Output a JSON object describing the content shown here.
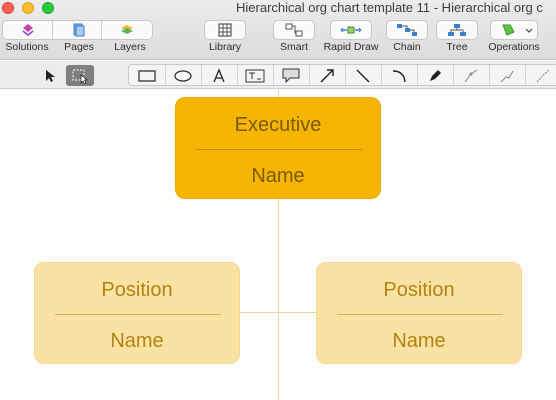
{
  "window": {
    "title": "Hierarchical org chart template 11 - Hierarchical org c"
  },
  "toolbar": {
    "solutions_label": "Solutions",
    "pages_label": "Pages",
    "layers_label": "Layers",
    "library_label": "Library",
    "smart_label": "Smart",
    "rapid_draw_label": "Rapid Draw",
    "chain_label": "Chain",
    "tree_label": "Tree",
    "operations_label": "Operations"
  },
  "drawing_tools": [
    "pointer-tool",
    "select-area-tool",
    "rectangle-tool",
    "ellipse-tool",
    "text-tool",
    "text-block-tool",
    "callout-tool",
    "arrow-tool",
    "line-tool",
    "arc-tool",
    "pen-tool",
    "bezier-tool",
    "polyline-tool",
    "spline-tool"
  ],
  "org_chart": {
    "executive": {
      "title": "Executive",
      "name": "Name"
    },
    "positions": [
      {
        "title": "Position",
        "name": "Name"
      },
      {
        "title": "Position",
        "name": "Name"
      }
    ]
  },
  "colors": {
    "executive_fill": "#f6b505",
    "position_fill": "#fae2a4",
    "connector": "#e8d79a"
  }
}
